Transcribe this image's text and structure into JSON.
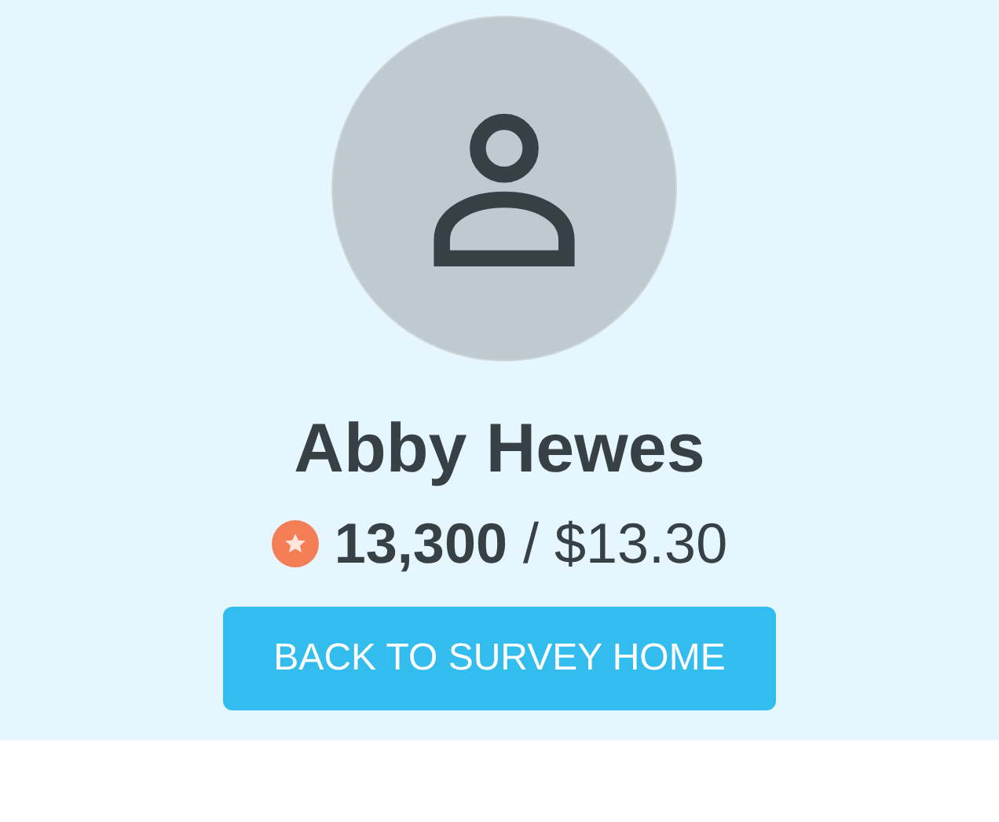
{
  "profile": {
    "name": "Abby Hewes",
    "points": "**13,300** / $13.30"
  },
  "button": {
    "label": "BACK TO SURVEY HOME"
  }
}
